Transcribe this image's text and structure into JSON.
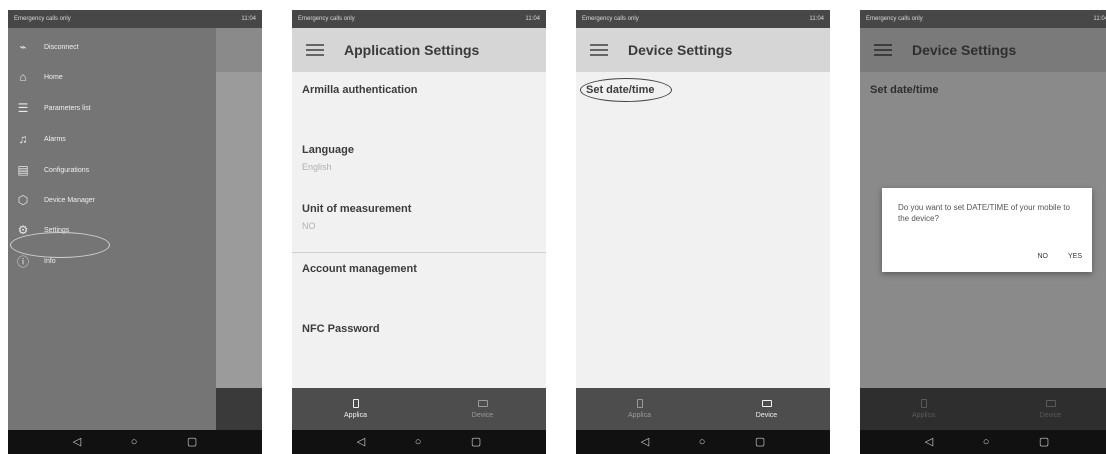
{
  "status_bar": {
    "left_text": "Emergency calls only",
    "right_text": "11:04"
  },
  "nav_bar": {
    "back": "◁",
    "home": "○",
    "recent": "▢"
  },
  "screen1": {
    "drawer_items": [
      {
        "icon": "disconnect-icon",
        "label": "Disconnect"
      },
      {
        "icon": "home-icon",
        "label": "Home"
      },
      {
        "icon": "list-icon",
        "label": "Parameters list"
      },
      {
        "icon": "bell-icon",
        "label": "Alarms"
      },
      {
        "icon": "clipboard-icon",
        "label": "Configurations"
      },
      {
        "icon": "cube-icon",
        "label": "Device Manager"
      },
      {
        "icon": "gear-icon",
        "label": "Settings"
      },
      {
        "icon": "info-icon",
        "label": "Info"
      }
    ]
  },
  "screen2": {
    "title": "Application Settings",
    "rows": [
      {
        "label": "Armilla authentication",
        "value": ""
      },
      {
        "label": "Language",
        "value": "English"
      },
      {
        "label": "Unit of measurement",
        "value": "NO"
      },
      {
        "label": "Account management",
        "value": ""
      },
      {
        "label": "NFC Password",
        "value": ""
      }
    ],
    "tabs": [
      {
        "icon": "phone-icon",
        "label": "Applica",
        "active": true
      },
      {
        "icon": "device-icon",
        "label": "Device",
        "active": false
      }
    ]
  },
  "screen3": {
    "title": "Device Settings",
    "rows": [
      {
        "label": "Set date/time"
      }
    ],
    "tabs": [
      {
        "icon": "phone-icon",
        "label": "Applica",
        "active": false
      },
      {
        "icon": "device-icon",
        "label": "Device",
        "active": true
      }
    ]
  },
  "screen4": {
    "title": "Device Settings",
    "rows": [
      {
        "label": "Set date/time"
      }
    ],
    "dialog": {
      "message": "Do you want to set DATE/TIME of your mobile to the device?",
      "no_label": "NO",
      "yes_label": "YES"
    },
    "tabs": [
      {
        "icon": "phone-icon",
        "label": "Applica",
        "active": false
      },
      {
        "icon": "device-icon",
        "label": "Device",
        "active": false
      }
    ]
  },
  "colors": {
    "appbar": "#d6d6d6",
    "drawer": "#757575",
    "tabbar": "#4d4d4d",
    "navbar": "#111111"
  }
}
